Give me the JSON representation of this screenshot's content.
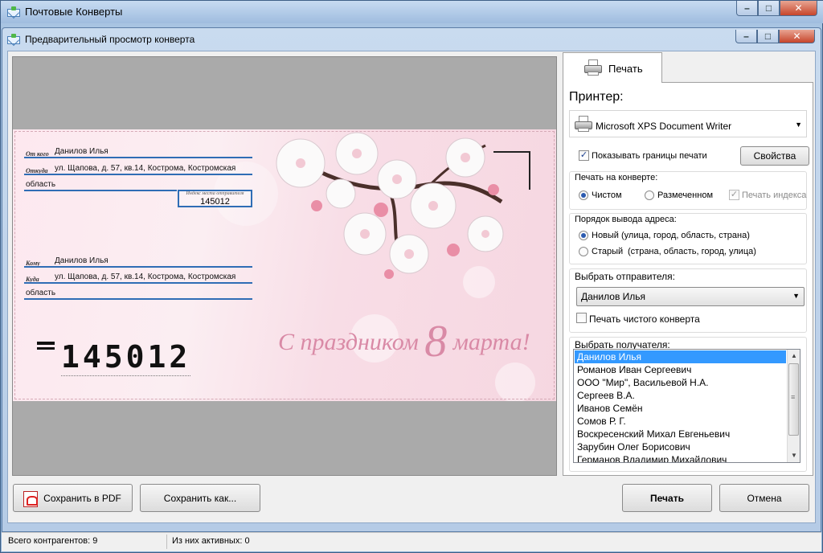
{
  "app": {
    "title": "Почтовые Конверты"
  },
  "dialog": {
    "title": "Предварительный просмотр конверта"
  },
  "caption_buttons": {
    "minimize": "–",
    "maximize": "□",
    "close": "✕"
  },
  "envelope": {
    "sender": {
      "label_from": "От кого",
      "name": "Данилов Илья",
      "label_where": "Откуда",
      "address_line1": "ул. Щапова, д. 57, кв.14, Кострома, Костромская",
      "address_line2": "область",
      "index_caption": "Индекс места отправителя",
      "index": "145012"
    },
    "recipient": {
      "label_to": "Кому",
      "name": "Данилов Илья",
      "label_where": "Куда",
      "address_line1": "ул. Щапова, д. 57, кв.14, Кострома, Костромская",
      "address_line2": "область"
    },
    "postcode_digits": "145012",
    "greeting_prefix": "С праздником",
    "greeting_number": "8",
    "greeting_suffix": "марта!"
  },
  "print_tab": {
    "label": "Печать",
    "icon": "printer-icon"
  },
  "panel": {
    "printer_heading": "Принтер:",
    "printer_name": "Microsoft XPS Document Writer",
    "show_print_bounds": "Показывать границы печати",
    "show_print_bounds_checked": true,
    "properties_button": "Свойства",
    "print_on_envelope": {
      "title": "Печать на конверте:",
      "clean": "Чистом",
      "marked": "Размеченном",
      "print_index": "Печать индекса",
      "selected": "clean"
    },
    "address_order": {
      "title": "Порядок вывода адреса:",
      "new_label": "Новый",
      "new_hint": "(улица, город, область, страна)",
      "old_label": "Старый",
      "old_hint": "(страна, область, город, улица)",
      "selected": "new"
    },
    "sender_select": {
      "title": "Выбрать отправителя:",
      "value": "Данилов Илья",
      "print_blank": "Печать чистого конверта"
    },
    "recipient_select": {
      "title": "Выбрать получателя:",
      "items": [
        "Данилов Илья",
        "Романов Иван Сергеевич",
        "ООО \"Мир\", Васильевой Н.А.",
        "Сергеев В.А.",
        "Иванов Семён",
        "Сомов Р. Г.",
        "Воскресенский Михал Евгеньевич",
        "Зарубин Олег Борисович",
        "Германов Владимир Михайлович"
      ],
      "selected_index": 0
    }
  },
  "footer": {
    "save_pdf": "Сохранить в PDF",
    "save_as": "Сохранить как...",
    "print": "Печать",
    "cancel": "Отмена"
  },
  "status": {
    "total": "Всего контрагентов: 9",
    "active": "Из них активных: 0"
  },
  "colors": {
    "accent_line": "#2f6db5",
    "selection": "#3399ff",
    "greeting": "#d98aa6"
  }
}
